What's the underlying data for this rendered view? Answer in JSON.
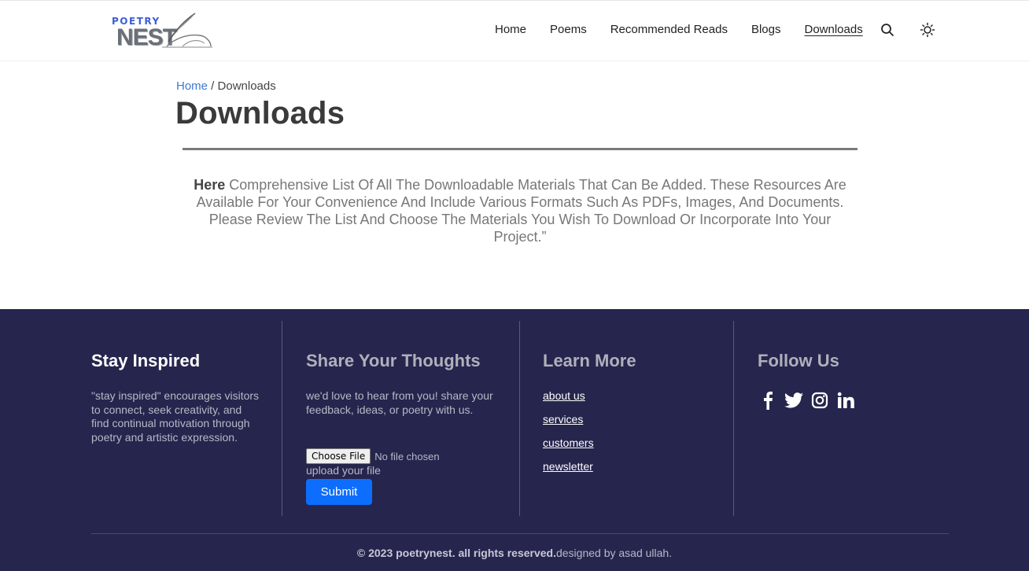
{
  "header": {
    "logo": {
      "top_text": "POETRY",
      "main_text": "NEST"
    },
    "nav": [
      {
        "label": "Home"
      },
      {
        "label": "Poems"
      },
      {
        "label": "Recommended Reads"
      },
      {
        "label": "Blogs"
      },
      {
        "label": "Downloads",
        "active": true
      }
    ],
    "icons": {
      "search": "search-icon",
      "theme": "sun-icon"
    }
  },
  "main": {
    "breadcrumb": {
      "home": "Home",
      "separator": " / ",
      "current": "Downloads"
    },
    "title": "Downloads",
    "intro_bold": "Here",
    "intro_text": " Comprehensive List Of All The Downloadable Materials That Can Be Added. These Resources Are Available For Your Convenience And Include Various Formats Such As PDFs, Images, And Documents. Please Review The List And Choose The Materials You Wish To Download Or Incorporate Into Your Project.”"
  },
  "footer": {
    "stay_inspired": {
      "heading": "Stay Inspired",
      "text": "\"stay inspired\" encourages visitors to connect, seek creativity, and find continual motivation through poetry and artistic expression."
    },
    "share": {
      "heading": "Share Your Thoughts",
      "text": "we'd love to hear from you! share your feedback, ideas, or poetry with us.",
      "file_button": "Choose File",
      "file_status": "No file chosen",
      "upload_label": "upload your file",
      "submit": "Submit"
    },
    "learn_more": {
      "heading": "Learn More",
      "links": [
        "about us",
        "services",
        "customers",
        "newsletter"
      ]
    },
    "follow": {
      "heading": "Follow Us",
      "icons": [
        "facebook-icon",
        "twitter-icon",
        "instagram-icon",
        "linkedin-icon"
      ]
    },
    "copyright_bold": "© 2023 poetrynest. all rights reserved.",
    "copyright_rest": "designed by asad ullah."
  },
  "colors": {
    "accent_link": "#3c78d8",
    "footer_bg": "#26254d",
    "submit_bg": "#0d6efd"
  }
}
